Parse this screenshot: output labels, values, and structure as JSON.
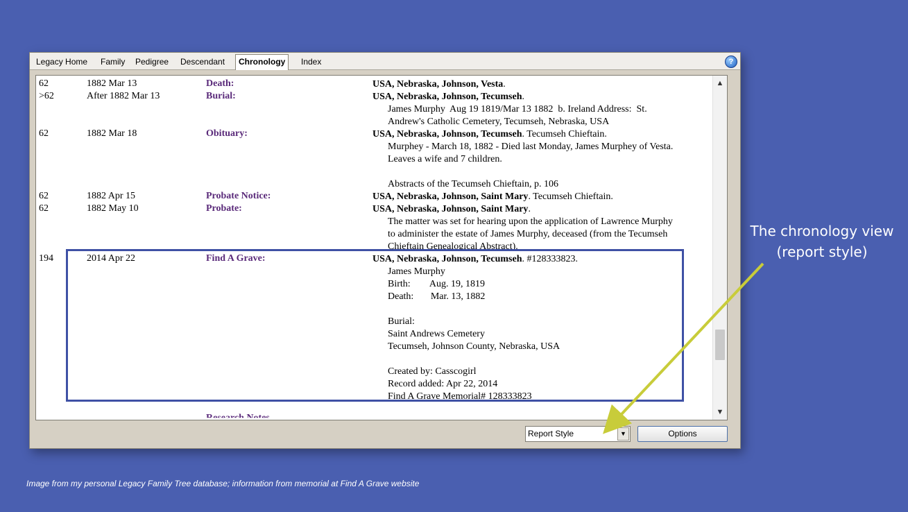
{
  "tabs": [
    "Legacy Home",
    "Family",
    "Pedigree",
    "Descendant",
    "Chronology",
    "Index"
  ],
  "help_glyph": "?",
  "rows": [
    {
      "age": "62",
      "date": "1882 Mar 13",
      "event": "Death:",
      "place": "USA, Nebraska, Johnson, Vesta",
      "after": ".",
      "notes": []
    },
    {
      "age": ">62",
      "date": "After 1882 Mar 13",
      "event": "Burial:",
      "place": "USA, Nebraska, Johnson, Tecumseh",
      "after": ".",
      "notes": [
        "James Murphy  Aug 19 1819/Mar 13 1882  b. Ireland Address:  St.",
        "Andrew's Catholic Cemetery, Tecumseh, Nebraska, USA"
      ]
    },
    {
      "age": "62",
      "date": "1882 Mar 18",
      "event": "Obituary:",
      "place": "USA, Nebraska, Johnson, Tecumseh",
      "after": ".  Tecumseh Chieftain.",
      "notes": [
        "Murphey - March 18, 1882 - Died last Monday, James Murphey of Vesta.",
        "Leaves a wife and 7 children.",
        "",
        "Abstracts of the Tecumseh Chieftain, p. 106"
      ]
    },
    {
      "age": "62",
      "date": "1882 Apr 15",
      "event": "Probate Notice:",
      "place": "USA, Nebraska, Johnson, Saint Mary",
      "after": ".  Tecumseh Chieftain.",
      "notes": []
    },
    {
      "age": "62",
      "date": "1882 May 10",
      "event": "Probate:",
      "place": "USA, Nebraska, Johnson, Saint Mary",
      "after": ".",
      "notes": [
        "The matter was set for hearing upon the application of Lawrence Murphy",
        "to administer the estate of James Murphy, deceased (from the Tecumseh",
        "Chieftain Genealogical Abstract)."
      ]
    },
    {
      "age": "194",
      "date": "2014 Apr 22",
      "event": "Find A Grave:",
      "place": "USA, Nebraska, Johnson, Tecumseh",
      "after": ".  #128333823.",
      "notes": [
        "James Murphy",
        "Birth:        Aug. 19, 1819",
        "Death:       Mar. 13, 1882",
        "",
        "Burial:",
        "Saint Andrews Cemetery",
        "Tecumseh, Johnson County, Nebraska, USA",
        "",
        "Created by: Casscogirl",
        "Record added: Apr 22, 2014",
        "Find A Grave Memorial# 128333823"
      ]
    }
  ],
  "cut_off_event": "Research Notes",
  "style_select": {
    "value": "Report Style"
  },
  "options_button": "Options",
  "callout": "The chronology view (report style)",
  "caption": "Image from  my personal Legacy Family Tree database; information from memorial at Find A Grave website",
  "colors": {
    "background": "#4a5fb0",
    "event_label": "#5a2a7a",
    "highlight_box": "#3f51a5",
    "arrow": "#c8cc3a"
  }
}
